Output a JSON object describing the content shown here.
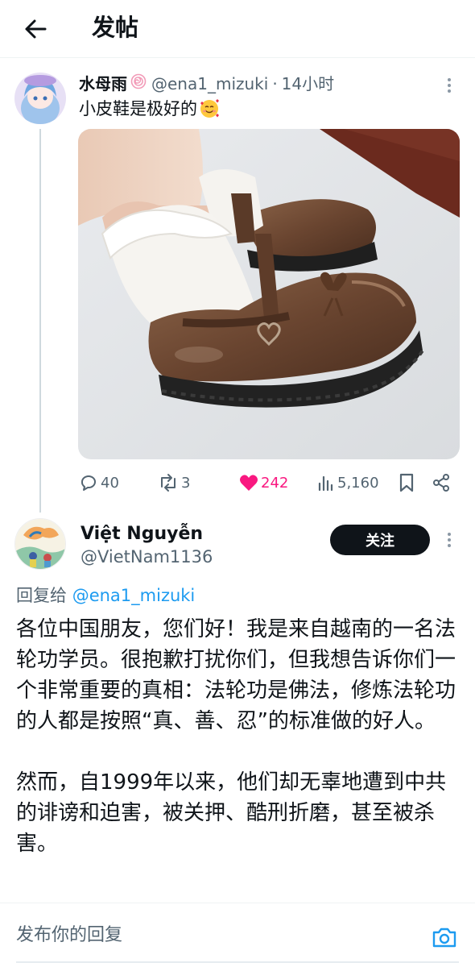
{
  "header": {
    "title": "发帖",
    "back_icon": "arrow-left-icon"
  },
  "post1": {
    "author_name": "水母雨",
    "handle": "@ena1_mizuki",
    "dot": "·",
    "time": "14小时",
    "text": "小皮鞋是极好的",
    "actions": {
      "replies": "40",
      "reposts": "3",
      "likes": "242",
      "views": "5,160"
    }
  },
  "post2": {
    "author_name": "Việt Nguyễn",
    "handle": "@VietNam1136",
    "follow_label": "关注",
    "reply_prefix": "回复给",
    "reply_handle": "@ena1_mizuki",
    "paragraph1": "各位中国朋友，您们好！我是来自越南的一名法轮功学员。很抱歉打扰你们，但我想告诉你们一个非常重要的真相：法轮功是佛法，修炼法轮功的人都是按照“真、善、忍”的标准做的好人。",
    "paragraph2": "然而，自1999年以来，他们却无辜地遭到中共的诽谤和迫害，被关押、酷刑折磨，甚至被杀害。"
  },
  "composer": {
    "placeholder": "发布你的回复"
  },
  "colors": {
    "accent": "#1d9bf0",
    "like": "#f91880",
    "text": "#0f1419",
    "muted": "#536471"
  }
}
